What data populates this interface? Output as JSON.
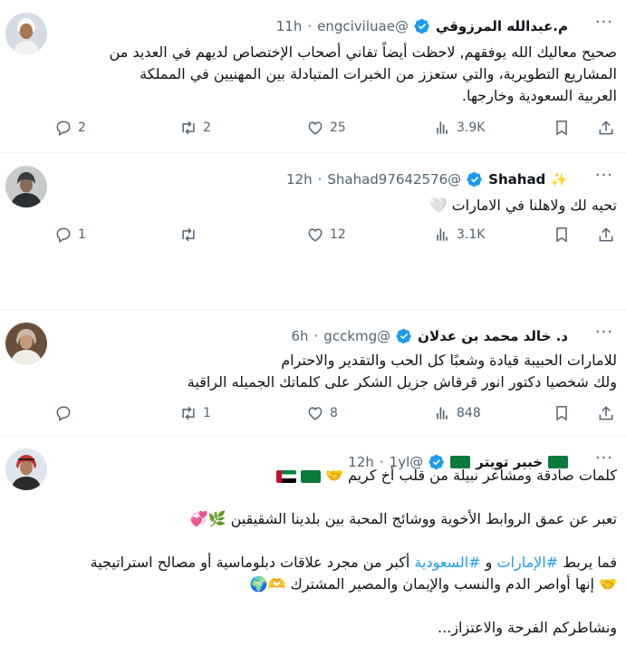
{
  "tweets": [
    {
      "name": "م.عبدالله المرزوقي",
      "handle": "@engciviluae",
      "time": "11h",
      "lines": [
        "صحيح معاليك الله يوفقهم, لاحظت أيضاً تفاني أصحاب الإختصاص لديهم في العديد من",
        "المشاريع التطويرية، والتي ستعزز من الخبرات المتبادلة بين المهنيين في المملكة",
        "العربية السعودية وخارجها."
      ],
      "replies": "2",
      "retweets": "2",
      "likes": "25",
      "views": "3.9K"
    },
    {
      "name": "Shahad",
      "handle": "@Shahad97642576",
      "time": "12h",
      "lines": [
        "تحيه لك ولاهلنا في الامارات 🤍"
      ],
      "replies": "1",
      "retweets": "",
      "likes": "12",
      "views": "3.1K"
    },
    {
      "name": "د. خالد محمد بن عدلان",
      "handle": "@gcckmg",
      "time": "6h",
      "lines": [
        "للامارات الحبيبة قيادة وشعبًا كل الحب والتقدير والاحترام",
        "ولك شخصيا دكتور انور قرقاش جزيل الشكر على كلماتك الجميله الراقية"
      ],
      "replies": "",
      "retweets": "1",
      "likes": "8",
      "views": "848"
    },
    {
      "name": "خبير تويتر",
      "handle": "@1yl",
      "time": "12h",
      "lines": [
        "كلمات صادقة ومشاعر نبيلة من قلب أخ كريم 🤝",
        "",
        "تعبر عن عمق الروابط الأخوية ووشائج المحبة بين بلدينا الشقيقين 🌿💞",
        "",
        "فما يربط",
        "أكبر من مجرد علاقات دبلوماسية أو مصالح استراتيجية",
        "🤝 إنها أواصر الدم والنسب والإيمان والمصير المشترك 🫶🌍",
        "",
        "ونشاطركم الفرحة والاعتزاز..."
      ],
      "hashtags": [
        "#الإمارات",
        "#السعودية"
      ],
      "connector": "و"
    }
  ],
  "icons": {
    "more": "more-dots-icon",
    "reply": "reply-icon",
    "retweet": "retweet-icon",
    "like": "heart-icon",
    "views": "views-icon",
    "bookmark": "bookmark-icon",
    "share": "share-icon",
    "verified": "verified-badge-icon"
  },
  "colors": {
    "verified": "#1d9bf0",
    "hashtag": "#1d9bf0",
    "muted": "#536471",
    "text": "#0f1419"
  }
}
